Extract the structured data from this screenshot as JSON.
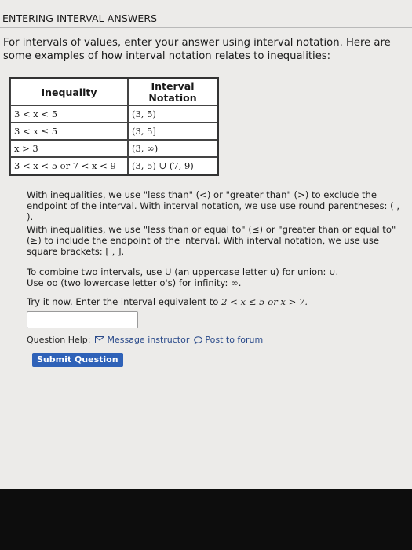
{
  "header": {
    "title": "ENTERING INTERVAL ANSWERS"
  },
  "intro": "For intervals of values, enter your answer using interval notation. Here are some examples of how interval notation relates to inequalities:",
  "table": {
    "headers": [
      "Inequality",
      "Interval Notation"
    ],
    "rows": [
      [
        "3 < x < 5",
        "(3, 5)"
      ],
      [
        "3 < x ≤ 5",
        "(3, 5]"
      ],
      [
        "x > 3",
        "(3, ∞)"
      ],
      [
        "3 < x < 5 or 7 < x < 9",
        "(3, 5) ∪ (7, 9)"
      ]
    ]
  },
  "paragraphs": {
    "p1": "With inequalities, we use \"less than\" (<) or \"greater than\" (>) to exclude the endpoint of the interval. With interval notation, we use use round parentheses: ( , ).",
    "p2": "With inequalities, we use \"less than or equal to\" (≤) or \"greater than or equal to\" (≥) to include the endpoint of the interval. With interval notation, we use use square brackets: [ , ].",
    "p3_line1": "To combine two intervals, use U (an uppercase letter u) for union: ∪.",
    "p3_line2": "Use oo (two lowercase letter o's) for infinity: ∞.",
    "try_prefix": "Try it now. Enter the interval equivalent to",
    "try_math": "2 < x ≤ 5 or x > 7."
  },
  "answer": {
    "value": ""
  },
  "help": {
    "label": "Question Help:",
    "message_link": "Message instructor",
    "forum_link": "Post to forum"
  },
  "submit_label": "Submit Question"
}
